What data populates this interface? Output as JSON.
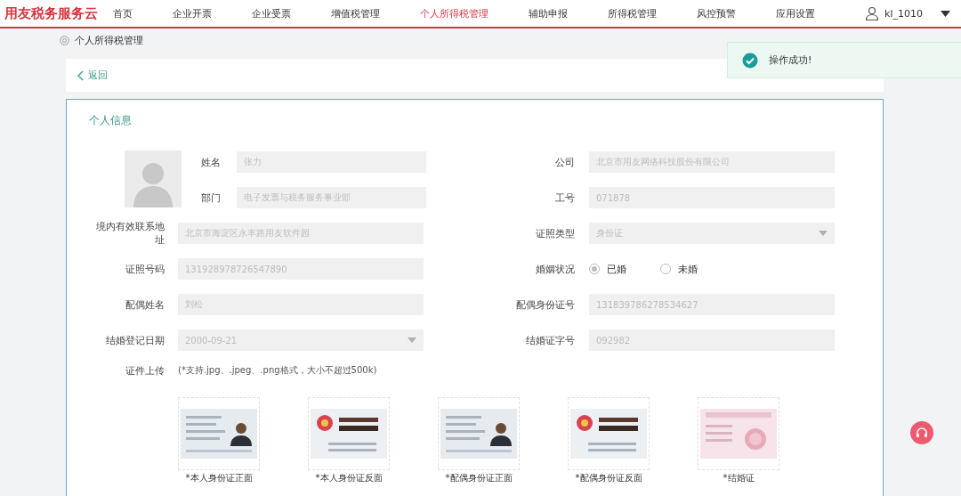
{
  "header": {
    "logo": "用友税务服务云",
    "nav": [
      {
        "label": "首页",
        "selected": false
      },
      {
        "label": "企业开票",
        "selected": false
      },
      {
        "label": "企业受票",
        "selected": false
      },
      {
        "label": "增值税管理",
        "selected": false
      },
      {
        "label": "个人所得税管理",
        "selected": true
      },
      {
        "label": "辅助申报",
        "selected": false
      },
      {
        "label": "所得税管理",
        "selected": false
      },
      {
        "label": "风控预警",
        "selected": false
      },
      {
        "label": "应用设置",
        "selected": false
      }
    ],
    "user": "kl_1010"
  },
  "breadcrumb": "个人所得税管理",
  "back": "返回",
  "toast": "操作成功!",
  "section_title": "个人信息",
  "left_top": [
    {
      "label": "姓名",
      "value": "张力",
      "kind": "input"
    },
    {
      "label": "部门",
      "value": "电子发票与税务服务事业部",
      "kind": "input"
    }
  ],
  "left": [
    {
      "label": "境内有效联系地址",
      "value": "北京市海淀区永丰路用友软件园",
      "kind": "input"
    },
    {
      "label": "证照号码",
      "value": "131928978726547890",
      "kind": "input"
    },
    {
      "label": "配偶姓名",
      "value": "刘松",
      "kind": "input"
    },
    {
      "label": "结婚登记日期",
      "value": "2000-09-21",
      "kind": "select"
    }
  ],
  "right": [
    {
      "label": "公司",
      "value": "北京市用友网络科技股份有限公司",
      "kind": "input"
    },
    {
      "label": "工号",
      "value": "071878",
      "kind": "input"
    },
    {
      "label": "证照类型",
      "value": "身份证",
      "kind": "select"
    },
    {
      "label": "婚姻状况",
      "kind": "radio",
      "options": [
        {
          "label": "已婚",
          "selected": true
        },
        {
          "label": "未婚",
          "selected": false
        }
      ]
    },
    {
      "label": "配偶身份证号",
      "value": "131839786278534627",
      "kind": "input"
    },
    {
      "label": "结婚证字号",
      "value": "092982",
      "kind": "input"
    }
  ],
  "upload": {
    "label": "证件上传",
    "hint": "(*支持.jpg、.jpeg、.png格式，大小不超过500k)",
    "items": [
      "*本人身份证正面",
      "*本人身份证反面",
      "*配偶身份证正面",
      "*配偶身份证反面",
      "*结婚证"
    ]
  }
}
